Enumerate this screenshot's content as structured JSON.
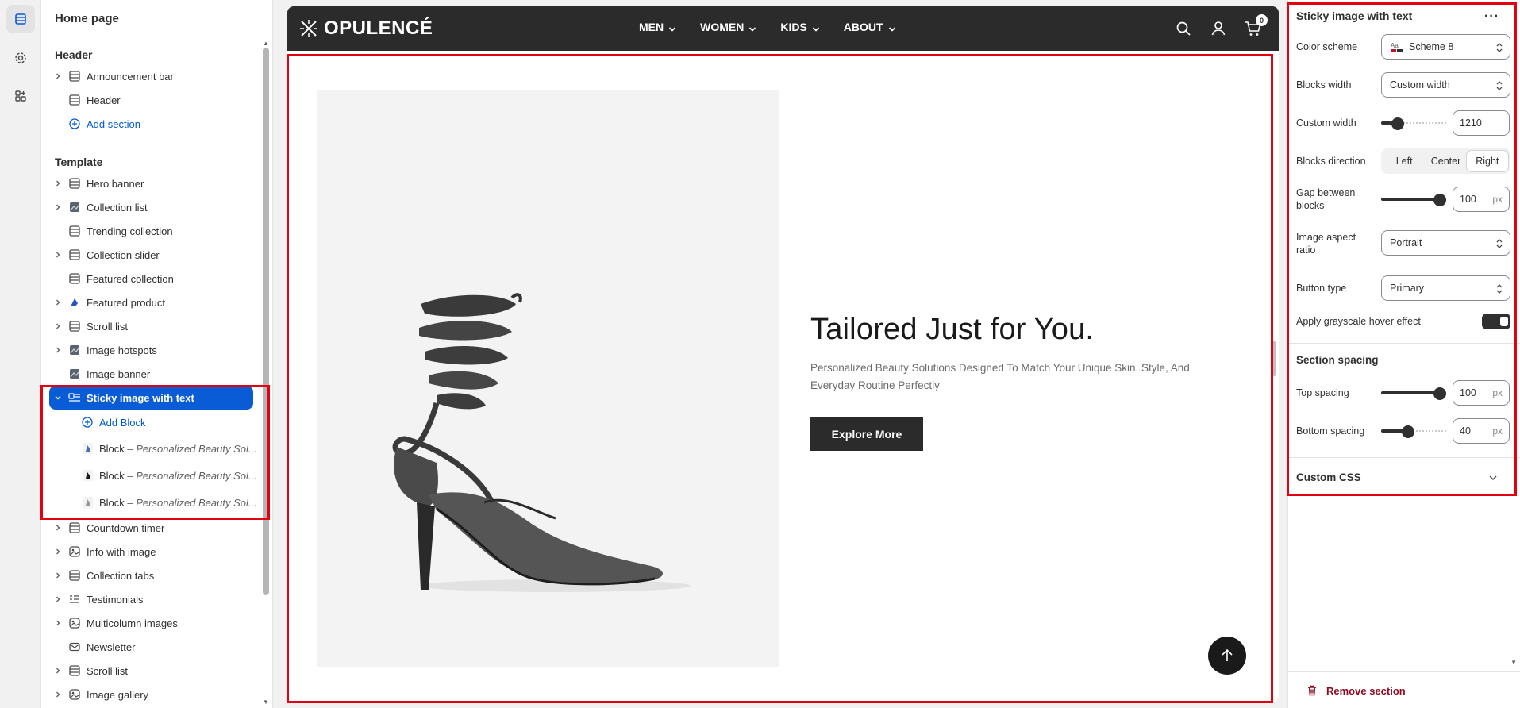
{
  "rail": {
    "items": [
      "sections-icon",
      "settings-icon",
      "apps-icon"
    ]
  },
  "sidebar": {
    "title": "Home page",
    "header_group": {
      "title": "Header",
      "items": [
        {
          "label": "Announcement bar",
          "expandable": true,
          "icon": "section-icon"
        },
        {
          "label": "Header",
          "expandable": false,
          "icon": "section-icon"
        }
      ],
      "add_label": "Add section"
    },
    "template_group": {
      "title": "Template",
      "items": [
        {
          "label": "Hero banner",
          "expandable": true,
          "icon": "section-icon"
        },
        {
          "label": "Collection list",
          "expandable": true,
          "icon": "image-thumb-icon"
        },
        {
          "label": "Trending collection",
          "expandable": false,
          "icon": "section-icon"
        },
        {
          "label": "Collection slider",
          "expandable": true,
          "icon": "section-icon"
        },
        {
          "label": "Featured collection",
          "expandable": false,
          "icon": "section-icon"
        },
        {
          "label": "Featured product",
          "expandable": true,
          "icon": "product-thumb-icon"
        },
        {
          "label": "Scroll list",
          "expandable": true,
          "icon": "section-icon"
        },
        {
          "label": "Image hotspots",
          "expandable": true,
          "icon": "image-thumb-icon"
        },
        {
          "label": "Image banner",
          "expandable": false,
          "icon": "image-thumb-icon"
        }
      ],
      "selected": {
        "label": "Sticky image with text",
        "icon": "image-with-text-icon"
      },
      "add_block_label": "Add Block",
      "blocks": [
        {
          "prefix": "Block",
          "detail": " – Personalized Beauty Sol..."
        },
        {
          "prefix": "Block",
          "detail": " – Personalized Beauty Sol..."
        },
        {
          "prefix": "Block",
          "detail": " – Personalized Beauty Sol..."
        }
      ],
      "after_items": [
        {
          "label": "Countdown timer",
          "expandable": true,
          "icon": "section-icon"
        },
        {
          "label": "Info with image",
          "expandable": true,
          "icon": "image-section-icon"
        },
        {
          "label": "Collection tabs",
          "expandable": true,
          "icon": "section-icon"
        },
        {
          "label": "Testimonials",
          "expandable": true,
          "icon": "list-icon"
        },
        {
          "label": "Multicolumn images",
          "expandable": true,
          "icon": "image-section-icon"
        },
        {
          "label": "Newsletter",
          "expandable": false,
          "icon": "mail-icon"
        },
        {
          "label": "Scroll list",
          "expandable": true,
          "icon": "section-icon"
        },
        {
          "label": "Image gallery",
          "expandable": true,
          "icon": "image-section-icon"
        }
      ]
    }
  },
  "preview": {
    "brand": "OPULENCÉ",
    "nav": [
      "MEN",
      "WOMEN",
      "KIDS",
      "ABOUT"
    ],
    "cart_count": "0",
    "hero_title": "Tailored Just for You.",
    "hero_subtitle": "Personalized Beauty Solutions Designed To Match Your Unique Skin, Style, And Everyday Routine Perfectly",
    "hero_button": "Explore More"
  },
  "panel": {
    "title": "Sticky image with text",
    "color_scheme_label": "Color scheme",
    "color_scheme_value": "Scheme 8",
    "blocks_width_label": "Blocks width",
    "blocks_width_value": "Custom width",
    "custom_width_label": "Custom width",
    "custom_width_value": "1210",
    "custom_width_fraction": 0.2,
    "blocks_direction_label": "Blocks direction",
    "direction_options": [
      "Left",
      "Center",
      "Right"
    ],
    "direction_selected": "Right",
    "gap_label": "Gap between blocks",
    "gap_value": "100",
    "gap_fraction": 1.0,
    "unit": "px",
    "aspect_label": "Image aspect ratio",
    "aspect_value": "Portrait",
    "button_type_label": "Button type",
    "button_type_value": "Primary",
    "grayscale_label": "Apply grayscale hover effect",
    "grayscale_on": true,
    "section_spacing_title": "Section spacing",
    "top_spacing_label": "Top spacing",
    "top_spacing_value": "100",
    "top_spacing_fraction": 1.0,
    "bottom_spacing_label": "Bottom spacing",
    "bottom_spacing_value": "40",
    "bottom_spacing_fraction": 0.4,
    "custom_css_label": "Custom CSS",
    "remove_label": "Remove section"
  },
  "colors": {
    "accent": "#0a5bd6",
    "highlight": "#e3000f",
    "nav_bg": "#2b2b2b",
    "danger": "#8e0b21"
  }
}
